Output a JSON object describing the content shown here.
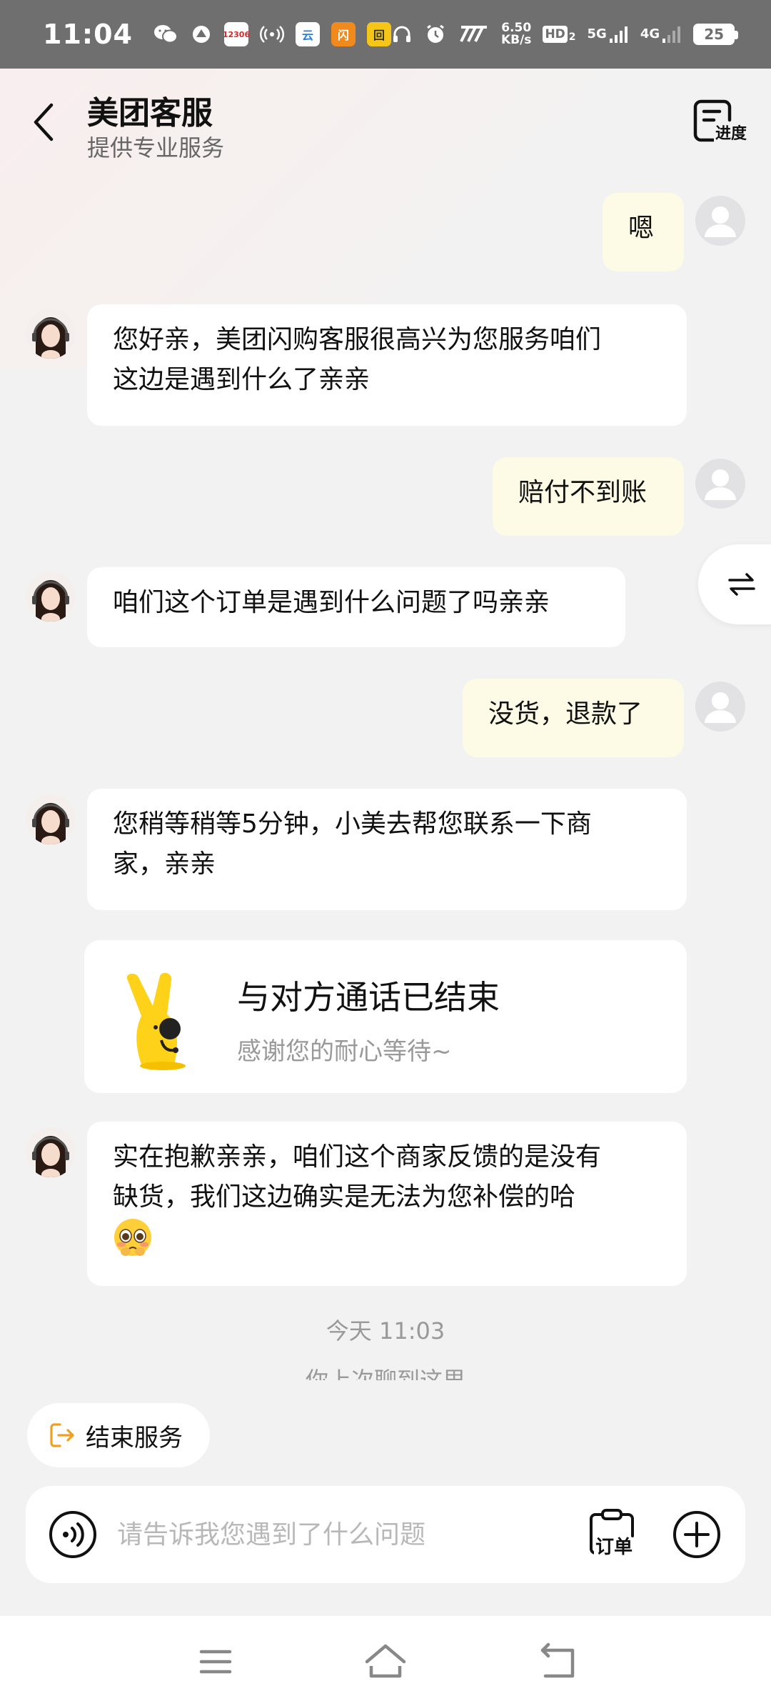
{
  "status_bar": {
    "time": "11:04",
    "net_speed_value": "6.50",
    "net_speed_unit": "KB/s",
    "hd_label": "HD",
    "hd_sub": "2",
    "sim1_label": "5G",
    "sim2_label": "4G",
    "battery": "25",
    "app_icons": [
      "wechat-icon",
      "app-icon",
      "12306-icon",
      "wifi-hotspot-icon",
      "app-icon",
      "app-icon",
      "app-icon"
    ],
    "app_icon_colors": [
      "#ffffff",
      "#ffffff",
      "#d7262b",
      "#ffffff",
      "#2a7fd4",
      "#f08a1c",
      "#f5c518"
    ],
    "app_icon_labels": [
      "",
      "",
      "12306",
      "",
      "云",
      "闪",
      "回"
    ]
  },
  "header": {
    "title": "美团客服",
    "subtitle": "提供专业服务",
    "progress_label": "进度"
  },
  "messages": [
    {
      "role": "user",
      "text": "嗯"
    },
    {
      "role": "agent",
      "lines": [
        "您好亲，美团闪购客服很高兴为您服务咱们",
        "这边是遇到什么了亲亲"
      ]
    },
    {
      "role": "user",
      "text": "赔付不到账"
    },
    {
      "role": "agent",
      "lines": [
        "咱们这个订单是遇到什么问题了吗亲亲"
      ]
    },
    {
      "role": "user",
      "text": "没货，退款了"
    },
    {
      "role": "agent",
      "lines": [
        "您稍等稍等5分钟，小美去帮您联系一下商",
        "家，亲亲"
      ]
    },
    {
      "role": "agent",
      "lines": [
        "实在抱歉亲亲，咱们这个商家反馈的是没有",
        "缺货，我们这边确实是无法为您补偿的哈"
      ],
      "emoji": "pleading-face-emoji"
    }
  ],
  "call_card": {
    "title": "与对方通话已结束",
    "subtitle": "感谢您的耐心等待~"
  },
  "timestamp": "今天 11:03",
  "history_hint": "你上次聊到这里",
  "end_service": {
    "label": "结束服务",
    "icon_color": "#f0a020"
  },
  "input": {
    "placeholder": "请告诉我您遇到了什么问题",
    "value": "",
    "order_label": "订单"
  },
  "colors": {
    "user_bubble": "#fdfbe6",
    "agent_bubble": "#ffffff",
    "background": "#f2f2f3",
    "accent": "#f0a020"
  }
}
